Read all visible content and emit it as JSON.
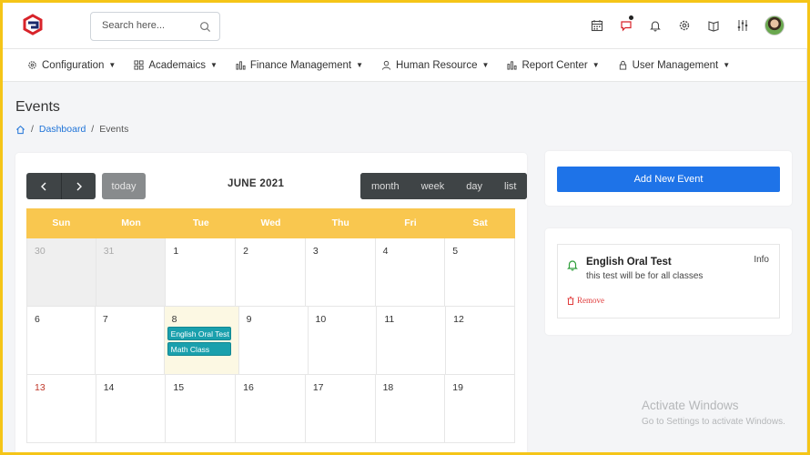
{
  "colors": {
    "accent": "#1e73e8",
    "header_yellow": "#f9c74f",
    "event": "#1aa0ad",
    "frame": "#f5c518"
  },
  "search": {
    "placeholder": "Search here..."
  },
  "topbar_icons": [
    "calendar-icon",
    "chat-icon",
    "bell-icon",
    "gear-icon",
    "book-icon",
    "sliders-icon"
  ],
  "menu": [
    {
      "label": "Configuration",
      "icon": "gear-icon"
    },
    {
      "label": "Academaics",
      "icon": "grid-icon"
    },
    {
      "label": "Finance Management",
      "icon": "bar-chart-icon"
    },
    {
      "label": "Human Resource",
      "icon": "user-icon"
    },
    {
      "label": "Report Center",
      "icon": "bar-chart-icon"
    },
    {
      "label": "User Management",
      "icon": "lock-icon"
    }
  ],
  "page": {
    "title": "Events",
    "breadcrumb": {
      "home": "Dashboard",
      "current": "Events"
    }
  },
  "calendar": {
    "title": "JUNE 2021",
    "today_label": "today",
    "views": [
      "month",
      "week",
      "day",
      "list"
    ],
    "weekdays": [
      "Sun",
      "Mon",
      "Tue",
      "Wed",
      "Thu",
      "Fri",
      "Sat"
    ],
    "weeks": [
      [
        "30",
        "31",
        "1",
        "2",
        "3",
        "4",
        "5"
      ],
      [
        "6",
        "7",
        "8",
        "9",
        "10",
        "11",
        "12"
      ],
      [
        "13",
        "14",
        "15",
        "16",
        "17",
        "18",
        "19"
      ]
    ],
    "events": [
      "English Oral Test",
      "Math Class"
    ]
  },
  "sidebar": {
    "add_button": "Add New Event",
    "event": {
      "title": "English Oral Test",
      "description": "this test will be for all classes",
      "tag": "Info",
      "remove": "Remove"
    }
  },
  "watermark": {
    "title": "Activate Windows",
    "subtitle": "Go to Settings to activate Windows."
  }
}
